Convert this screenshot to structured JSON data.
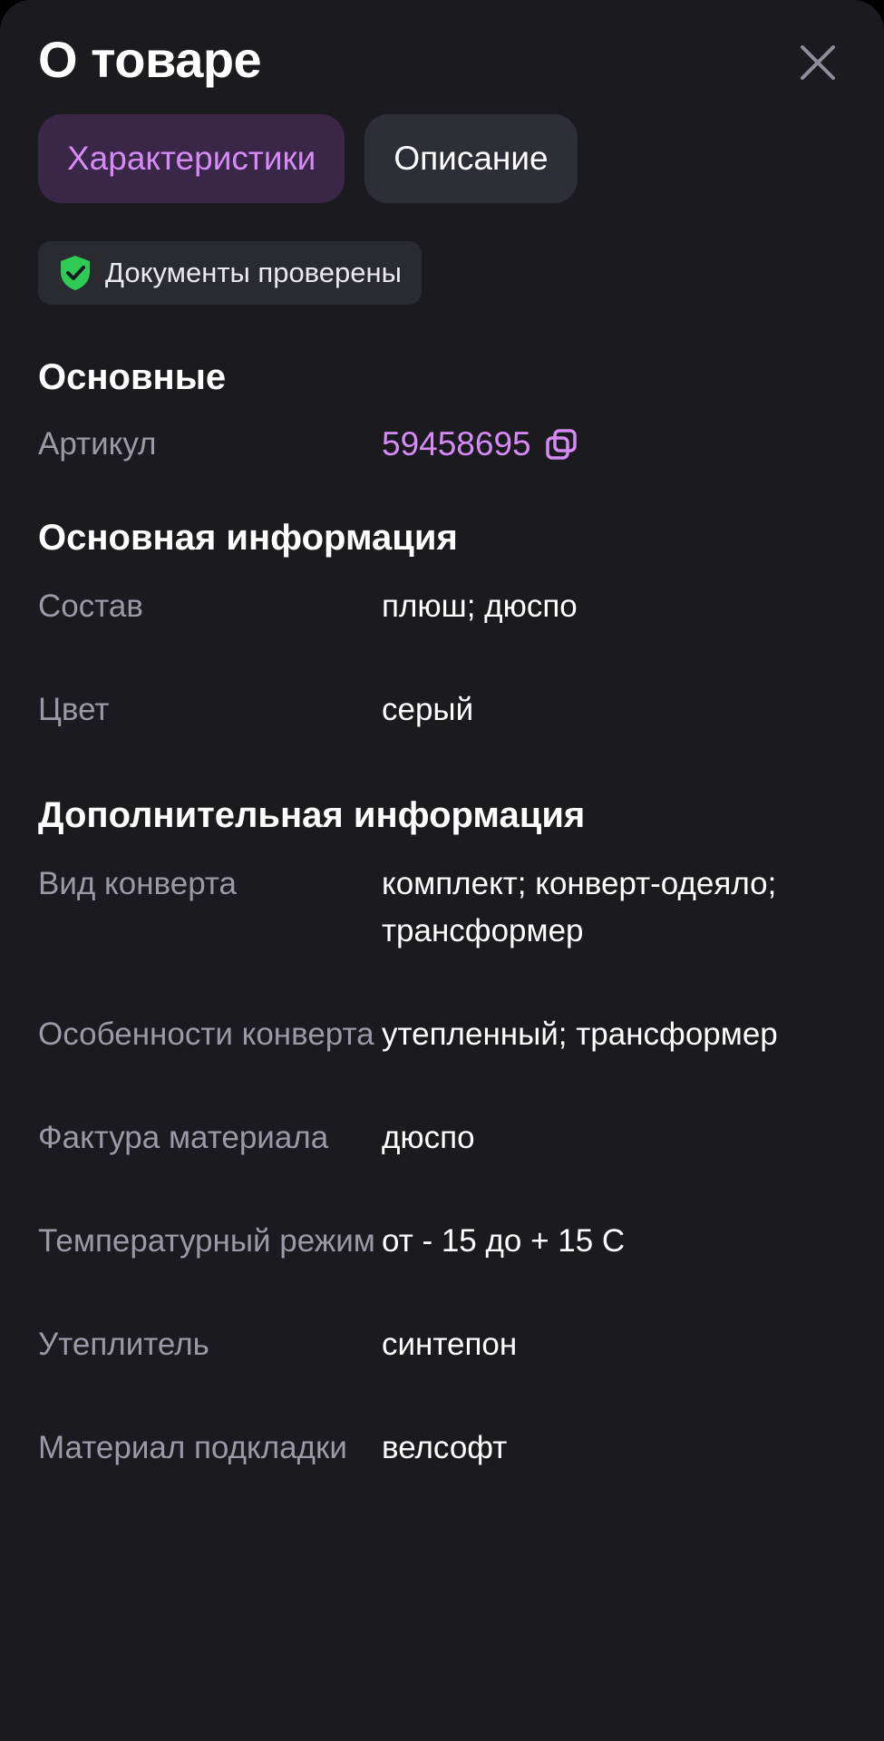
{
  "header": {
    "title": "О товаре"
  },
  "tabs": [
    {
      "label": "Характеристики",
      "active": true
    },
    {
      "label": "Описание",
      "active": false
    }
  ],
  "docs_badge": {
    "label": "Документы проверены",
    "icon": "shield-check-icon",
    "color": "#2ecc55"
  },
  "sections": {
    "main": {
      "title": "Основные",
      "article": {
        "key": "Артикул",
        "value": "59458695"
      }
    },
    "basic_info": {
      "title": "Основная информация",
      "rows": [
        {
          "key": "Состав",
          "value": "плюш; дюспо"
        },
        {
          "key": "Цвет",
          "value": "серый"
        }
      ]
    },
    "extra_info": {
      "title": "Дополнительная информация",
      "rows": [
        {
          "key": "Вид конверта",
          "value": "комплект; конверт-одеяло; трансформер"
        },
        {
          "key": "Особенности конверта",
          "value": "утепленный; трансформер"
        },
        {
          "key": "Фактура материала",
          "value": "дюспо"
        },
        {
          "key": "Температурный режим",
          "value": "от - 15 до + 15 С"
        },
        {
          "key": "Утеплитель",
          "value": "синтепон"
        },
        {
          "key": "Материал подкладки",
          "value": "велсофт"
        }
      ]
    }
  },
  "colors": {
    "background": "#1a1a1f",
    "accent": "#d58af5",
    "muted_text": "#9a99a5"
  }
}
